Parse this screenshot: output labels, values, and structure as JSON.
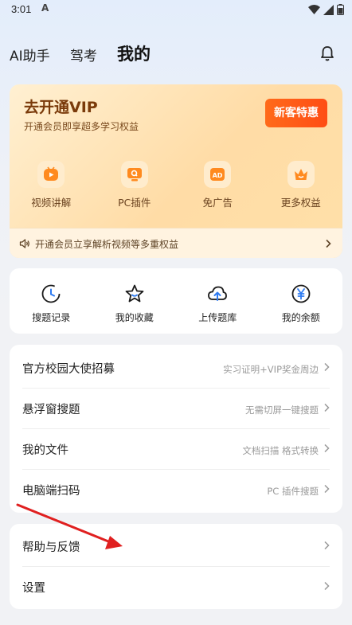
{
  "status": {
    "time": "3:01",
    "a_icon": "A"
  },
  "nav": {
    "tabs": [
      "AI助手",
      "驾考",
      "我的"
    ],
    "bell_icon": "bell-icon"
  },
  "vip": {
    "title": "去开通VIP",
    "subtitle": "开通会员即享超多学习权益",
    "button": "新客特惠",
    "features": [
      {
        "label": "视频讲解",
        "icon": "video-play-icon"
      },
      {
        "label": "PC插件",
        "icon": "pc-plugin-icon"
      },
      {
        "label": "免广告",
        "icon": "ad-free-icon"
      },
      {
        "label": "更多权益",
        "icon": "crown-icon"
      }
    ],
    "banner": "开通会员立享解析视频等多重权益"
  },
  "quick": [
    {
      "label": "搜题记录",
      "icon": "clock-icon"
    },
    {
      "label": "我的收藏",
      "icon": "star-icon"
    },
    {
      "label": "上传题库",
      "icon": "cloud-upload-icon"
    },
    {
      "label": "我的余额",
      "icon": "yen-icon"
    }
  ],
  "menu": [
    {
      "label": "官方校园大使招募",
      "hint": "实习证明+VIP奖金周边"
    },
    {
      "label": "悬浮窗搜题",
      "hint": "无需切屏一键搜题"
    },
    {
      "label": "我的文件",
      "hint": "文档扫描 格式转换"
    },
    {
      "label": "电脑端扫码",
      "hint": "PC 插件搜题"
    }
  ],
  "menu2": [
    {
      "label": "帮助与反馈"
    },
    {
      "label": "设置"
    }
  ],
  "colors": {
    "accent": "#ff5a1a",
    "vip_text": "#7a3a0a",
    "arrow": "#e02020"
  }
}
